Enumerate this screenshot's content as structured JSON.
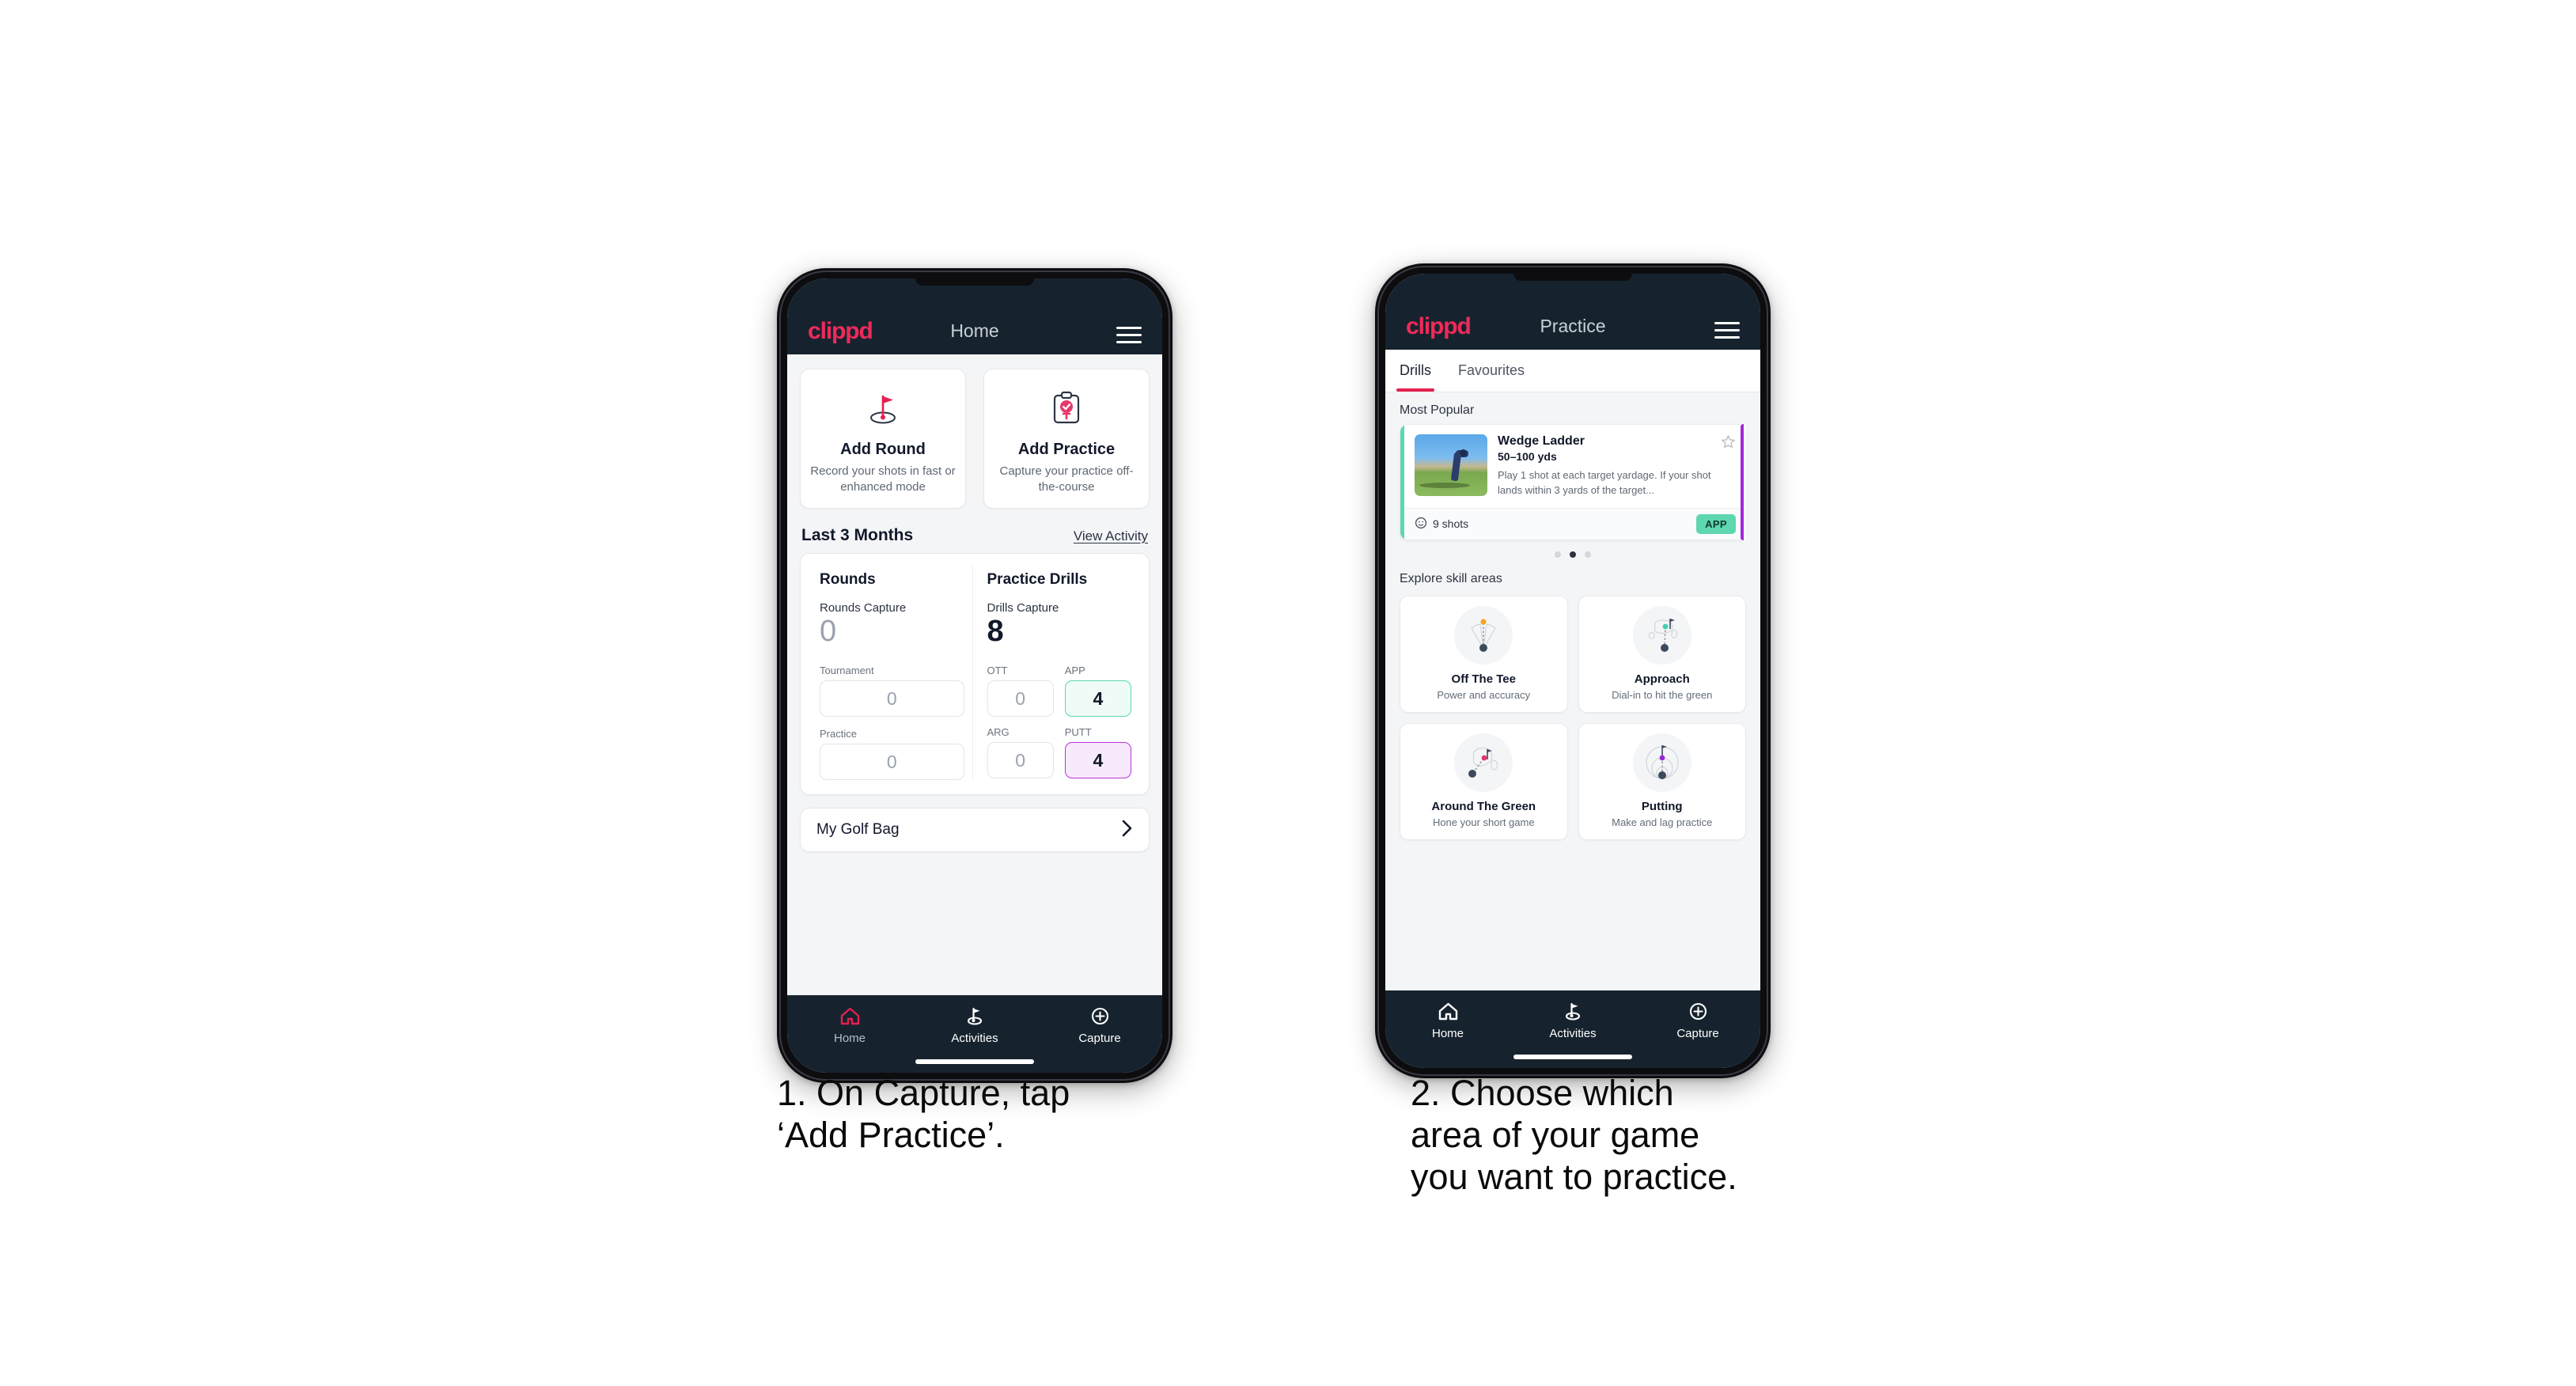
{
  "brand": {
    "name": "clippd",
    "accent": "#ef2a5a",
    "dark": "#16232e"
  },
  "phone1": {
    "appbar": {
      "logo": "clippd",
      "title": "Home",
      "menu_icon": "hamburger-menu-icon"
    },
    "actions": [
      {
        "icon": "golf-flag-icon",
        "title": "Add Round",
        "desc": "Record your shots in fast or enhanced mode"
      },
      {
        "icon": "clipboard-check-icon",
        "title": "Add Practice",
        "desc": "Capture your practice off-the-course"
      }
    ],
    "section": {
      "title": "Last 3 Months",
      "link": "View Activity"
    },
    "rounds": {
      "heading": "Rounds",
      "capture_label": "Rounds Capture",
      "capture_value": "0",
      "items": [
        {
          "label": "Tournament",
          "value": "0",
          "state": "empty"
        },
        {
          "label": "Practice",
          "value": "0",
          "state": "empty"
        }
      ]
    },
    "drills": {
      "heading": "Practice Drills",
      "capture_label": "Drills Capture",
      "capture_value": "8",
      "items": [
        {
          "label": "OTT",
          "value": "0",
          "state": "empty"
        },
        {
          "label": "APP",
          "value": "4",
          "state": "app"
        },
        {
          "label": "ARG",
          "value": "0",
          "state": "empty"
        },
        {
          "label": "PUTT",
          "value": "4",
          "state": "putt"
        }
      ]
    },
    "bag": {
      "label": "My Golf Bag",
      "chevron": "chevron-right-icon"
    },
    "bottomnav": [
      {
        "icon": "home-icon",
        "label": "Home",
        "active": true
      },
      {
        "icon": "golf-flag-icon",
        "label": "Activities",
        "active": false
      },
      {
        "icon": "plus-circle-icon",
        "label": "Capture",
        "active": false
      }
    ]
  },
  "phone2": {
    "appbar": {
      "logo": "clippd",
      "title": "Practice",
      "menu_icon": "hamburger-menu-icon"
    },
    "tabs": [
      {
        "label": "Drills",
        "active": true
      },
      {
        "label": "Favourites",
        "active": false
      }
    ],
    "most_popular_label": "Most Popular",
    "drill": {
      "name": "Wedge Ladder",
      "yardage": "50–100 yds",
      "desc": "Play 1 shot at each target yardage. If your shot lands within 3 yards of the target...",
      "shots": "9 shots",
      "badge": "APP",
      "badge_color": "#5ed6b0",
      "accent_color": "#5ed6b0",
      "star_icon": "star-outline-icon",
      "clock_icon": "clock-icon",
      "thumbnail": "golfer-photo"
    },
    "carousel_dots": {
      "count": 3,
      "active_index": 1
    },
    "explore_label": "Explore skill areas",
    "skills": [
      {
        "icon": "off-the-tee-icon",
        "name": "Off The Tee",
        "desc": "Power and accuracy",
        "dot": "#f5a623"
      },
      {
        "icon": "approach-icon",
        "name": "Approach",
        "desc": "Dial-in to hit the green",
        "dot": "#3ecfb0"
      },
      {
        "icon": "around-the-green-icon",
        "name": "Around The Green",
        "desc": "Hone your short game",
        "dot": "#e5386d"
      },
      {
        "icon": "putting-icon",
        "name": "Putting",
        "desc": "Make and lag practice",
        "dot": "#9b27d6"
      }
    ],
    "bottomnav": [
      {
        "icon": "home-icon",
        "label": "Home",
        "active": false
      },
      {
        "icon": "golf-flag-icon",
        "label": "Activities",
        "active": false
      },
      {
        "icon": "plus-circle-icon",
        "label": "Capture",
        "active": false
      }
    ]
  },
  "captions": {
    "one": "1. On Capture, tap\n‘Add Practice’.",
    "two": "2. Choose which\narea of your game\nyou want to practice."
  }
}
